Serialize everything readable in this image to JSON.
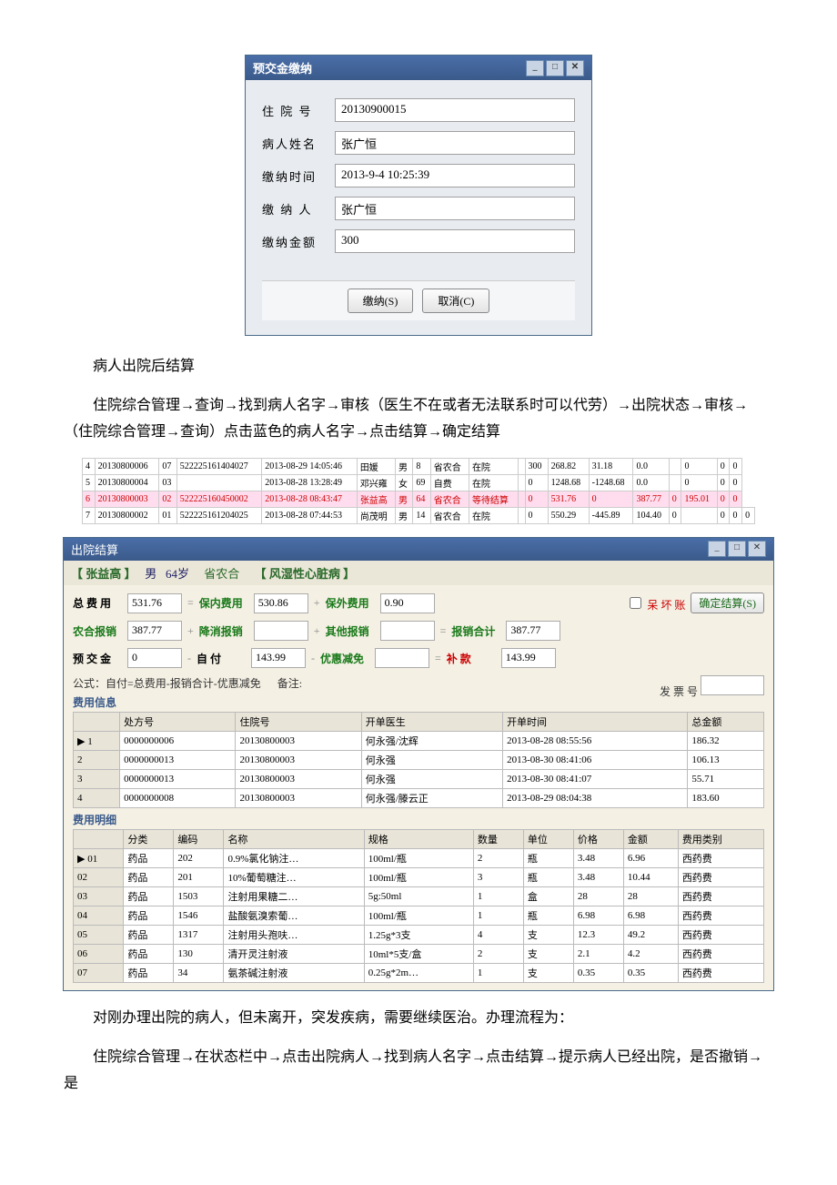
{
  "deposit_dialog": {
    "title": "预交金缴纳",
    "rows": {
      "admission_no_label": "住 院 号",
      "admission_no": "20130900015",
      "patient_name_label": "病人姓名",
      "patient_name": "张广恒",
      "pay_time_label": "缴纳时间",
      "pay_time": "2013-9-4 10:25:39",
      "payer_label": "缴 纳 人",
      "payer": "张广恒",
      "amount_label": "缴纳金额",
      "amount": "300"
    },
    "btn_submit": "缴纳(S)",
    "btn_cancel": "取消(C)"
  },
  "text1": "病人出院后结算",
  "text2": "住院综合管理→查询→找到病人名字→审核（医生不在或者无法联系时可以代劳）→出院状态→审核→（住院综合管理→查询）点击蓝色的病人名字→点击结算→确定结算",
  "mini_rows": [
    [
      "4",
      "20130800006",
      "07",
      "522225161404027",
      "2013-08-29 14:05:46",
      "田媛",
      "男",
      "8",
      "省农合",
      "在院",
      "",
      "300",
      "268.82",
      "31.18",
      "0.0",
      "",
      "0",
      "0",
      "0"
    ],
    [
      "5",
      "20130800004",
      "03",
      "",
      "2013-08-28 13:28:49",
      "邓兴雍",
      "女",
      "69",
      "自费",
      "在院",
      "",
      "0",
      "1248.68",
      "-1248.68",
      "0.0",
      "",
      "0",
      "0",
      "0"
    ],
    [
      "6",
      "20130800003",
      "02",
      "522225160450002",
      "2013-08-28 08:43:47",
      "张益高",
      "男",
      "64",
      "省农合",
      "等待结算",
      "",
      "0",
      "531.76",
      "0",
      "387.77",
      "0",
      "195.01",
      "0",
      "0"
    ],
    [
      "7",
      "20130800002",
      "01",
      "522225161204025",
      "2013-08-28 07:44:53",
      "尚茂明",
      "男",
      "14",
      "省农合",
      "在院",
      "",
      "0",
      "550.29",
      "-445.89",
      "104.40",
      "0",
      "",
      "0",
      "0",
      "0"
    ]
  ],
  "settle": {
    "win_title": "出院结算",
    "patient_line": "【 张益高 】",
    "sex": "男",
    "age": "64岁",
    "ins": "省农合",
    "diag": "【 风湿性心脏病 】",
    "total_fee_label": "总 费 用",
    "total_fee": "531.76",
    "eq": "=",
    "innerfee_label": "保内费用",
    "innerfee": "530.86",
    "plus": "+",
    "outerfee_label": "保外费用",
    "outerfee": "0.90",
    "badacct_label": "呆 坏 账",
    "ok_btn": "确定结算(S)",
    "nongbao_label": "农合报销",
    "nongbao": "387.77",
    "surg_label": "降消报销",
    "surg": "",
    "other_label": "其他报销",
    "other": "",
    "baosum_label": "报销合计",
    "baosum": "387.77",
    "deposit_label": "预 交 金",
    "deposit": "0",
    "minus": "-",
    "self_label": "自    付",
    "self": "143.99",
    "discount_label": "优惠减免",
    "refund_label": "补  款",
    "refund": "143.99",
    "formula": "公式：自付=总费用-报销合计-优惠减免",
    "note_label": "备注:",
    "invoice_label": "发 票 号",
    "fee_info_label": "费用信息",
    "fee_detail_label": "费用明细",
    "fee_cols": [
      "",
      "处方号",
      "住院号",
      "开单医生",
      "开单时间",
      "总金额"
    ],
    "fee_rows": [
      [
        "▶ 1",
        "0000000006",
        "20130800003",
        "何永强/沈辉",
        "2013-08-28 08:55:56",
        "186.32"
      ],
      [
        "2",
        "0000000013",
        "20130800003",
        "何永强",
        "2013-08-30 08:41:06",
        "106.13"
      ],
      [
        "3",
        "0000000013",
        "20130800003",
        "何永强",
        "2013-08-30 08:41:07",
        "55.71"
      ],
      [
        "4",
        "0000000008",
        "20130800003",
        "何永强/滕云正",
        "2013-08-29 08:04:38",
        "183.60"
      ]
    ],
    "detail_cols": [
      "",
      "分类",
      "编码",
      "名称",
      "规格",
      "数量",
      "单位",
      "价格",
      "金额",
      "费用类别"
    ],
    "detail_rows": [
      [
        "▶ 01",
        "药品",
        "202",
        "0.9%氯化钠注…",
        "100ml/瓶",
        "2",
        "瓶",
        "3.48",
        "6.96",
        "西药费"
      ],
      [
        "02",
        "药品",
        "201",
        "10%葡萄糖注…",
        "100ml/瓶",
        "3",
        "瓶",
        "3.48",
        "10.44",
        "西药费"
      ],
      [
        "03",
        "药品",
        "1503",
        "注射用果糖二…",
        "5g:50ml",
        "1",
        "盒",
        "28",
        "28",
        "西药费"
      ],
      [
        "04",
        "药品",
        "1546",
        "盐酸氨溴索葡…",
        "100ml/瓶",
        "1",
        "瓶",
        "6.98",
        "6.98",
        "西药费"
      ],
      [
        "05",
        "药品",
        "1317",
        "注射用头孢呋…",
        "1.25g*3支",
        "4",
        "支",
        "12.3",
        "49.2",
        "西药费"
      ],
      [
        "06",
        "药品",
        "130",
        "清开灵注射液",
        "10ml*5支/盒",
        "2",
        "支",
        "2.1",
        "4.2",
        "西药费"
      ],
      [
        "07",
        "药品",
        "34",
        "氨茶碱注射液",
        "0.25g*2m…",
        "1",
        "支",
        "0.35",
        "0.35",
        "西药费"
      ]
    ]
  },
  "text3": "对刚办理出院的病人，但未离开，突发疾病，需要继续医治。办理流程为：",
  "text4": "住院综合管理→在状态栏中→点击出院病人→找到病人名字→点击结算→提示病人已经出院，是否撤销→是"
}
